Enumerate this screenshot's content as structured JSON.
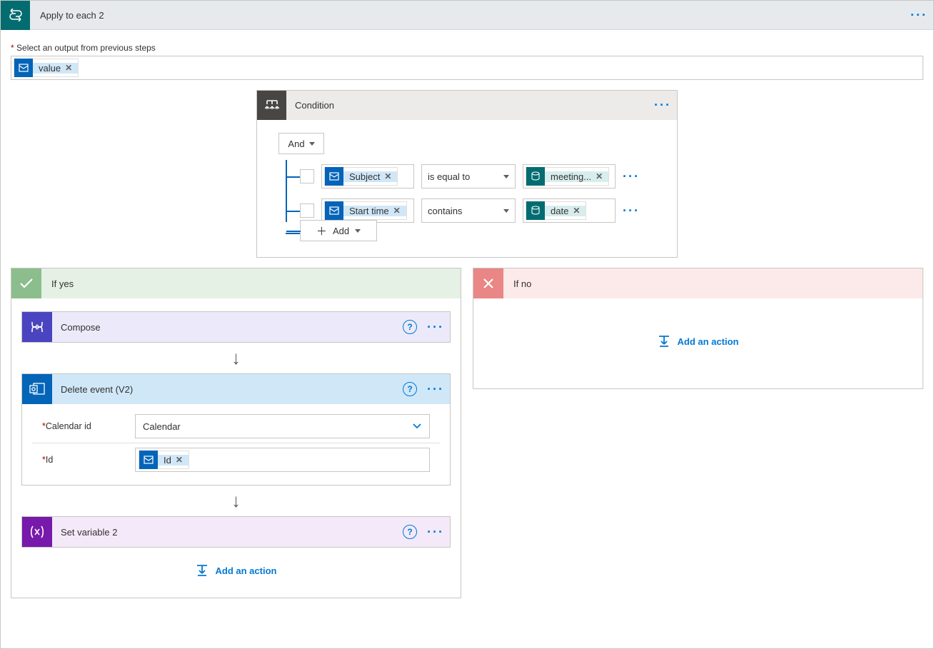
{
  "apply_to_each": {
    "title": "Apply to each 2",
    "select_output_label": "Select an output from previous steps",
    "output_token": "value"
  },
  "condition": {
    "title": "Condition",
    "group_op": "And",
    "rows": [
      {
        "left_token": "Subject",
        "operator": "is equal to",
        "right_token": "meeting..."
      },
      {
        "left_token": "Start time",
        "operator": "contains",
        "right_token": "date"
      }
    ],
    "add_label": "Add"
  },
  "branches": {
    "yes_label": "If yes",
    "no_label": "If no",
    "add_action_label": "Add an action"
  },
  "yes_actions": {
    "compose": {
      "title": "Compose"
    },
    "delete_event": {
      "title": "Delete event (V2)",
      "cal_label": "Calendar id",
      "cal_value": "Calendar",
      "id_label": "Id",
      "id_token": "Id"
    },
    "set_var": {
      "title": "Set variable 2"
    }
  }
}
